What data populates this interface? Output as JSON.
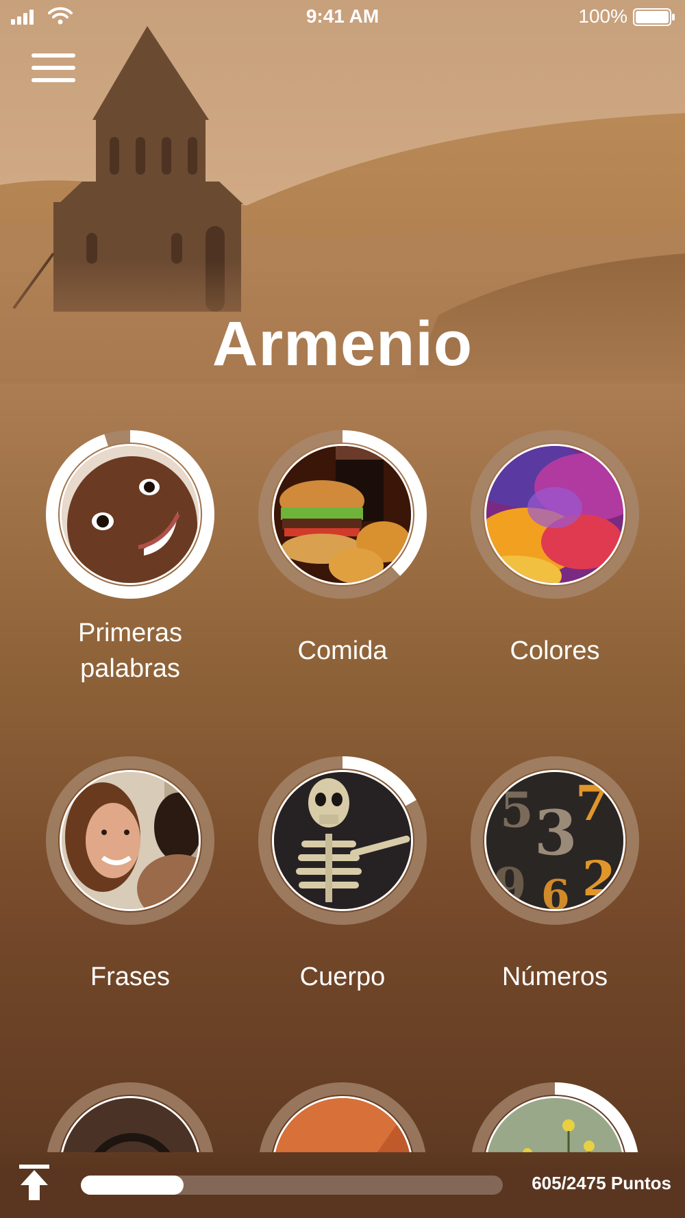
{
  "status_bar": {
    "time": "9:41 AM",
    "battery": "100%"
  },
  "header": {
    "menu_icon": "hamburger-icon"
  },
  "language": {
    "title": "Armenio"
  },
  "topics": [
    {
      "label_line1": "Primeras",
      "label_line2": "palabras",
      "progress": 0.95,
      "photo": "baby-face"
    },
    {
      "label_line1": "Comida",
      "label_line2": "",
      "progress": 0.38,
      "photo": "burger-food"
    },
    {
      "label_line1": "Colores",
      "label_line2": "",
      "progress": 0.0,
      "photo": "color-powder"
    },
    {
      "label_line1": "Frases",
      "label_line2": "",
      "progress": 0.0,
      "photo": "smiling-people"
    },
    {
      "label_line1": "Cuerpo",
      "label_line2": "",
      "progress": 0.17,
      "photo": "skeleton"
    },
    {
      "label_line1": "Números",
      "label_line2": "",
      "progress": 0.0,
      "photo": "number-blocks"
    },
    {
      "label_line1": "",
      "label_line2": "",
      "progress": 0.0,
      "photo": "headphones"
    },
    {
      "label_line1": "",
      "label_line2": "",
      "progress": 0.0,
      "photo": "orange-room"
    },
    {
      "label_line1": "",
      "label_line2": "",
      "progress": 0.3,
      "photo": "flowers"
    }
  ],
  "footer": {
    "upload_icon": "upload-arrow-icon",
    "points_text": "605/2475 Puntos",
    "points_progress": 0.244
  },
  "colors": {
    "ring_bg": "#a88a70",
    "ring_fg": "#ffffff"
  }
}
